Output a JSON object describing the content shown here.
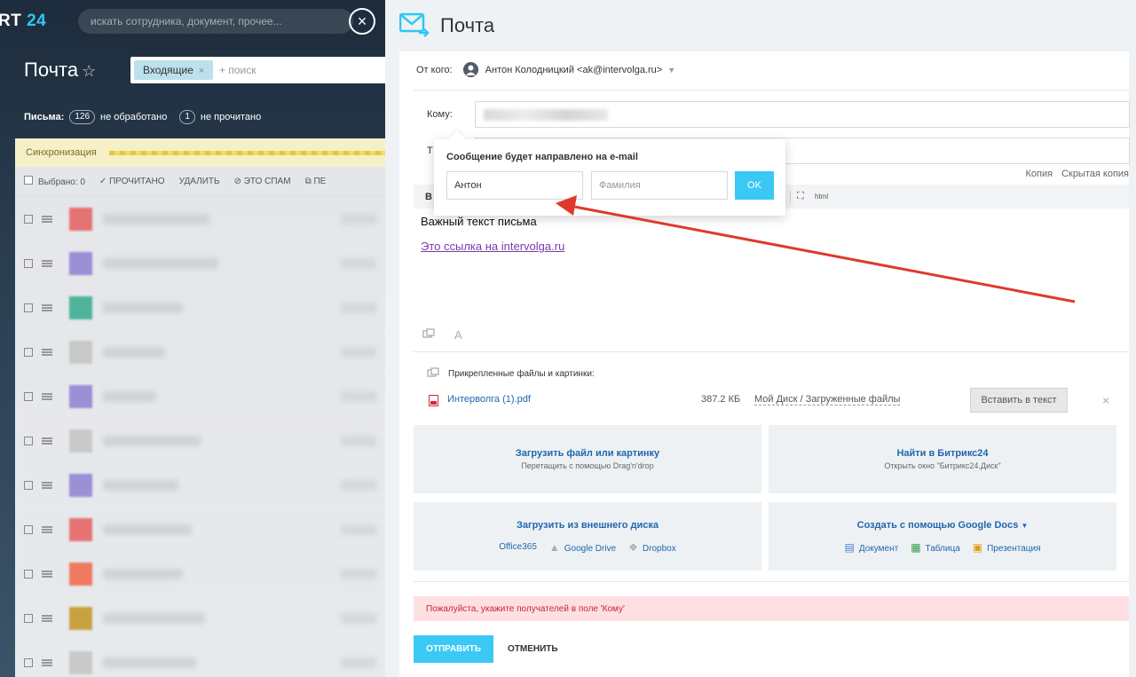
{
  "background_app": {
    "logo_text": "RT",
    "logo_num": "24",
    "search_placeholder": "искать сотрудника, документ, прочее...",
    "close_glyph": "×",
    "page_title": "Почта",
    "star_glyph": "☆",
    "filter_chip": "Входящие",
    "filter_chip_remove": "×",
    "filter_placeholder": "+ поиск",
    "stats_label": "Письма:",
    "stats_unprocessed_count": "126",
    "stats_unprocessed_label": "не обработано",
    "stats_unread_count": "1",
    "stats_unread_label": "не прочитано",
    "sync_label": "Синхронизация",
    "toolbar": {
      "selected": "Выбрано: 0",
      "read": "✓ ПРОЧИТАНО",
      "delete": "УДАЛИТЬ",
      "spam": "⊘ ЭТО СПАМ",
      "more": "⧉ ПЕ"
    },
    "row_colors": [
      "#e57373",
      "#9b8fd6",
      "#4db39a",
      "#c9c9c9",
      "#9b8fd6",
      "#c9c9c9",
      "#9b8fd6",
      "#e57373",
      "#ef7a60",
      "#c9a13f",
      "#c9c9c9"
    ]
  },
  "slider": {
    "title": "Почта",
    "from_label": "От кого:",
    "from_value": "Антон Колодницкий <ak@intervolga.ru>",
    "to_label": "Кому:",
    "theme_label": "Т",
    "copy_link": "Копия",
    "hidden_copy_link": "Скрытая копия",
    "editor_bold": "B",
    "editor_html": "html",
    "message_text": "Важный текст письма",
    "message_link": "Это ссылка на intervolga.ru",
    "editor_font_icon": "A",
    "attachments_title": "Прикрепленные файлы и картинки:",
    "attachment": {
      "name": "Интерволга (1).pdf",
      "size": "387.2 КБ",
      "source": "Мой Диск / Загруженные файлы",
      "insert_button": "Вставить в текст",
      "remove": "×"
    },
    "tiles": {
      "upload_title": "Загрузить файл или картинку",
      "upload_sub": "Перетащить с помощью Drag'n'drop",
      "find_title": "Найти в Битрикс24",
      "find_sub": "Открыть окно \"Битрикс24.Диск\"",
      "external_title": "Загрузить из внешнего диска",
      "external_links": [
        "Office365",
        "Google Drive",
        "Dropbox"
      ],
      "gdocs_title": "Создать с помощью Google Docs",
      "gdocs_links": [
        "Документ",
        "Таблица",
        "Презентация"
      ]
    },
    "warning": "Пожалуйста, укажите получателей в поле 'Кому'",
    "send_button": "ОТПРАВИТЬ",
    "cancel_button": "ОТМЕНИТЬ"
  },
  "popup": {
    "title": "Сообщение будет направлено на e-mail",
    "first_name_value": "Антон",
    "last_name_placeholder": "Фамилия",
    "ok_button": "OK"
  },
  "colors": {
    "accent": "#3bc8f5",
    "link": "#2067b0",
    "warning_bg": "#ffe0e2",
    "annotation_arrow": "#e0392b"
  }
}
